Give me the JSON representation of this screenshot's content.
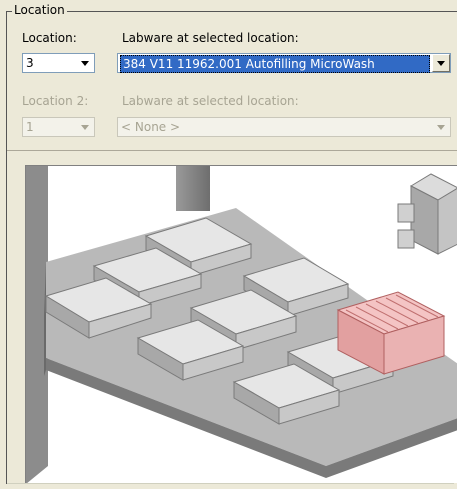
{
  "group": {
    "title": "Location"
  },
  "location": {
    "label": "Location:",
    "value": "3",
    "labware_label": "Labware at selected location:",
    "labware_value": "384 V11 11962.001 Autofilling MicroWash"
  },
  "location2": {
    "label": "Location 2:",
    "value": "1",
    "labware_label": "Labware at selected location:",
    "labware_value": "< None >"
  },
  "colors": {
    "highlight": "#e8a0a0",
    "selection": "#316ac5"
  }
}
